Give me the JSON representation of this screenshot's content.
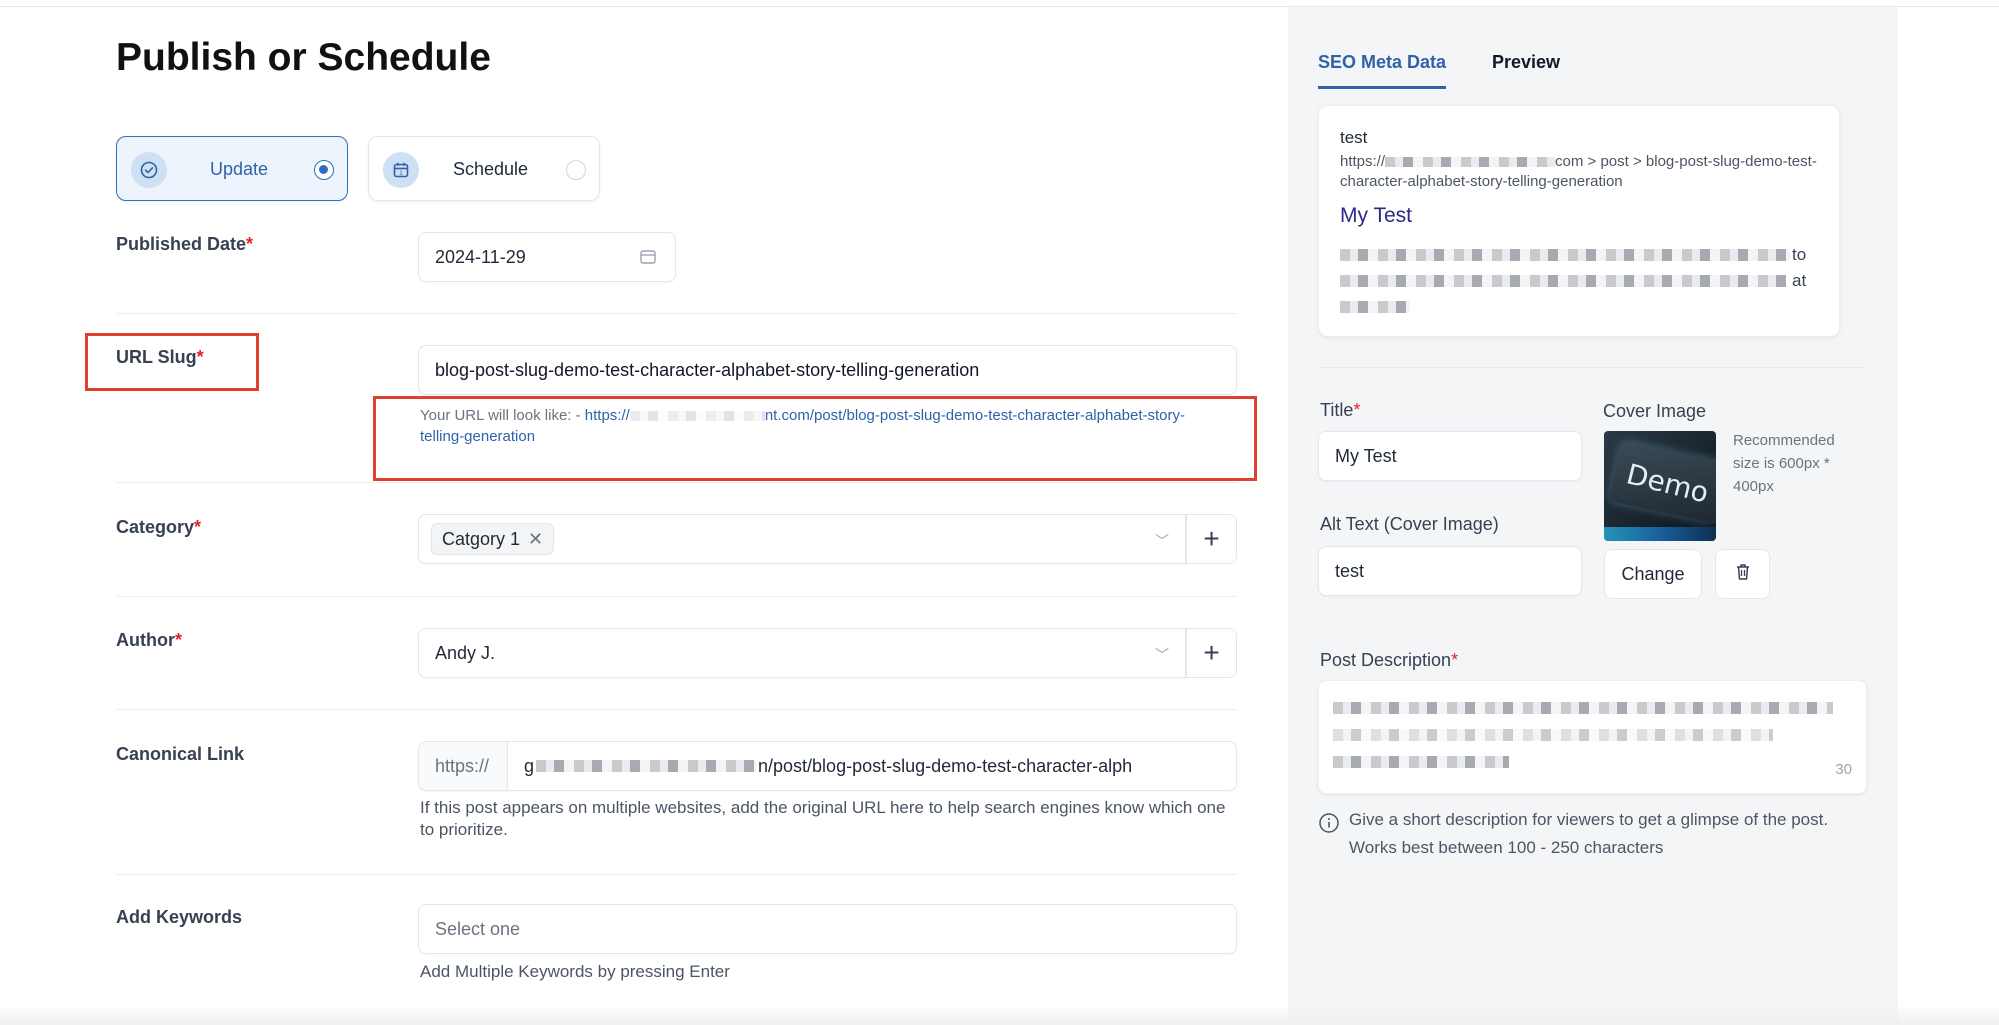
{
  "page": {
    "title": "Publish or Schedule"
  },
  "publish_options": [
    {
      "label": "Update",
      "selected": true,
      "icon": "check-circle-icon"
    },
    {
      "label": "Schedule",
      "selected": false,
      "icon": "calendar-icon"
    }
  ],
  "fields": {
    "published_date": {
      "label": "Published Date",
      "required_mark": "*",
      "value": "2024-11-29"
    },
    "url_slug": {
      "label": "URL Slug",
      "required_mark": "*",
      "value": "blog-post-slug-demo-test-character-alphabet-story-telling-generation",
      "hint_prefix": "Your URL will look like: - ",
      "hint_url_start": "https://",
      "hint_url_rest": "nt.com/post/blog-post-slug-demo-test-character-alphabet-story-telling-generation"
    },
    "category": {
      "label": "Category",
      "required_mark": "*",
      "tag": "Catgory 1"
    },
    "author": {
      "label": "Author",
      "required_mark": "*",
      "value": "Andy J."
    },
    "canonical": {
      "label": "Canonical Link",
      "prefix": "https://",
      "value_start": "g",
      "value_rest": "n/post/blog-post-slug-demo-test-character-alph",
      "hint": "If this post appears on multiple websites, add the original URL here to help search engines know which one to prioritize."
    },
    "keywords": {
      "label": "Add Keywords",
      "placeholder": "Select one",
      "hint": "Add Multiple Keywords by pressing Enter"
    }
  },
  "seo_panel": {
    "tabs": [
      "SEO Meta Data",
      "Preview"
    ],
    "preview": {
      "site_name": "test",
      "url_start": "https://",
      "url_rest": "com > post > blog-post-slug-demo-test-character-alphabet-story-telling-generation",
      "title": "My Test",
      "desc_tail_1": "to",
      "desc_tail_2": "at"
    },
    "title_field": {
      "label": "Title",
      "required_mark": "*",
      "value": "My Test"
    },
    "cover": {
      "label": "Cover Image",
      "recommend": "Recommended size is 600px * 400px",
      "image_text": "Demo",
      "change_label": "Change"
    },
    "alt_text": {
      "label": "Alt Text (Cover Image)",
      "value": "test"
    },
    "post_description": {
      "label": "Post Description",
      "required_mark": "*",
      "count_tail": "30",
      "info": "Give a short description for viewers to get a glimpse of the post. Works best between 100 - 250 characters"
    }
  },
  "colors": {
    "accent": "#2f62a8",
    "required": "#e02424",
    "highlight_box": "#e0402f",
    "panel_bg": "#f4f5f7"
  }
}
